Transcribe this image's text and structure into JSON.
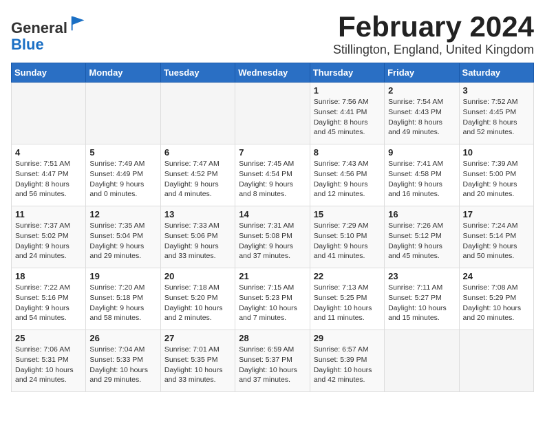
{
  "header": {
    "logo_general": "General",
    "logo_blue": "Blue",
    "title": "February 2024",
    "subtitle": "Stillington, England, United Kingdom"
  },
  "weekdays": [
    "Sunday",
    "Monday",
    "Tuesday",
    "Wednesday",
    "Thursday",
    "Friday",
    "Saturday"
  ],
  "weeks": [
    [
      {
        "day": "",
        "info": ""
      },
      {
        "day": "",
        "info": ""
      },
      {
        "day": "",
        "info": ""
      },
      {
        "day": "",
        "info": ""
      },
      {
        "day": "1",
        "info": "Sunrise: 7:56 AM\nSunset: 4:41 PM\nDaylight: 8 hours\nand 45 minutes."
      },
      {
        "day": "2",
        "info": "Sunrise: 7:54 AM\nSunset: 4:43 PM\nDaylight: 8 hours\nand 49 minutes."
      },
      {
        "day": "3",
        "info": "Sunrise: 7:52 AM\nSunset: 4:45 PM\nDaylight: 8 hours\nand 52 minutes."
      }
    ],
    [
      {
        "day": "4",
        "info": "Sunrise: 7:51 AM\nSunset: 4:47 PM\nDaylight: 8 hours\nand 56 minutes."
      },
      {
        "day": "5",
        "info": "Sunrise: 7:49 AM\nSunset: 4:49 PM\nDaylight: 9 hours\nand 0 minutes."
      },
      {
        "day": "6",
        "info": "Sunrise: 7:47 AM\nSunset: 4:52 PM\nDaylight: 9 hours\nand 4 minutes."
      },
      {
        "day": "7",
        "info": "Sunrise: 7:45 AM\nSunset: 4:54 PM\nDaylight: 9 hours\nand 8 minutes."
      },
      {
        "day": "8",
        "info": "Sunrise: 7:43 AM\nSunset: 4:56 PM\nDaylight: 9 hours\nand 12 minutes."
      },
      {
        "day": "9",
        "info": "Sunrise: 7:41 AM\nSunset: 4:58 PM\nDaylight: 9 hours\nand 16 minutes."
      },
      {
        "day": "10",
        "info": "Sunrise: 7:39 AM\nSunset: 5:00 PM\nDaylight: 9 hours\nand 20 minutes."
      }
    ],
    [
      {
        "day": "11",
        "info": "Sunrise: 7:37 AM\nSunset: 5:02 PM\nDaylight: 9 hours\nand 24 minutes."
      },
      {
        "day": "12",
        "info": "Sunrise: 7:35 AM\nSunset: 5:04 PM\nDaylight: 9 hours\nand 29 minutes."
      },
      {
        "day": "13",
        "info": "Sunrise: 7:33 AM\nSunset: 5:06 PM\nDaylight: 9 hours\nand 33 minutes."
      },
      {
        "day": "14",
        "info": "Sunrise: 7:31 AM\nSunset: 5:08 PM\nDaylight: 9 hours\nand 37 minutes."
      },
      {
        "day": "15",
        "info": "Sunrise: 7:29 AM\nSunset: 5:10 PM\nDaylight: 9 hours\nand 41 minutes."
      },
      {
        "day": "16",
        "info": "Sunrise: 7:26 AM\nSunset: 5:12 PM\nDaylight: 9 hours\nand 45 minutes."
      },
      {
        "day": "17",
        "info": "Sunrise: 7:24 AM\nSunset: 5:14 PM\nDaylight: 9 hours\nand 50 minutes."
      }
    ],
    [
      {
        "day": "18",
        "info": "Sunrise: 7:22 AM\nSunset: 5:16 PM\nDaylight: 9 hours\nand 54 minutes."
      },
      {
        "day": "19",
        "info": "Sunrise: 7:20 AM\nSunset: 5:18 PM\nDaylight: 9 hours\nand 58 minutes."
      },
      {
        "day": "20",
        "info": "Sunrise: 7:18 AM\nSunset: 5:20 PM\nDaylight: 10 hours\nand 2 minutes."
      },
      {
        "day": "21",
        "info": "Sunrise: 7:15 AM\nSunset: 5:23 PM\nDaylight: 10 hours\nand 7 minutes."
      },
      {
        "day": "22",
        "info": "Sunrise: 7:13 AM\nSunset: 5:25 PM\nDaylight: 10 hours\nand 11 minutes."
      },
      {
        "day": "23",
        "info": "Sunrise: 7:11 AM\nSunset: 5:27 PM\nDaylight: 10 hours\nand 15 minutes."
      },
      {
        "day": "24",
        "info": "Sunrise: 7:08 AM\nSunset: 5:29 PM\nDaylight: 10 hours\nand 20 minutes."
      }
    ],
    [
      {
        "day": "25",
        "info": "Sunrise: 7:06 AM\nSunset: 5:31 PM\nDaylight: 10 hours\nand 24 minutes."
      },
      {
        "day": "26",
        "info": "Sunrise: 7:04 AM\nSunset: 5:33 PM\nDaylight: 10 hours\nand 29 minutes."
      },
      {
        "day": "27",
        "info": "Sunrise: 7:01 AM\nSunset: 5:35 PM\nDaylight: 10 hours\nand 33 minutes."
      },
      {
        "day": "28",
        "info": "Sunrise: 6:59 AM\nSunset: 5:37 PM\nDaylight: 10 hours\nand 37 minutes."
      },
      {
        "day": "29",
        "info": "Sunrise: 6:57 AM\nSunset: 5:39 PM\nDaylight: 10 hours\nand 42 minutes."
      },
      {
        "day": "",
        "info": ""
      },
      {
        "day": "",
        "info": ""
      }
    ]
  ]
}
